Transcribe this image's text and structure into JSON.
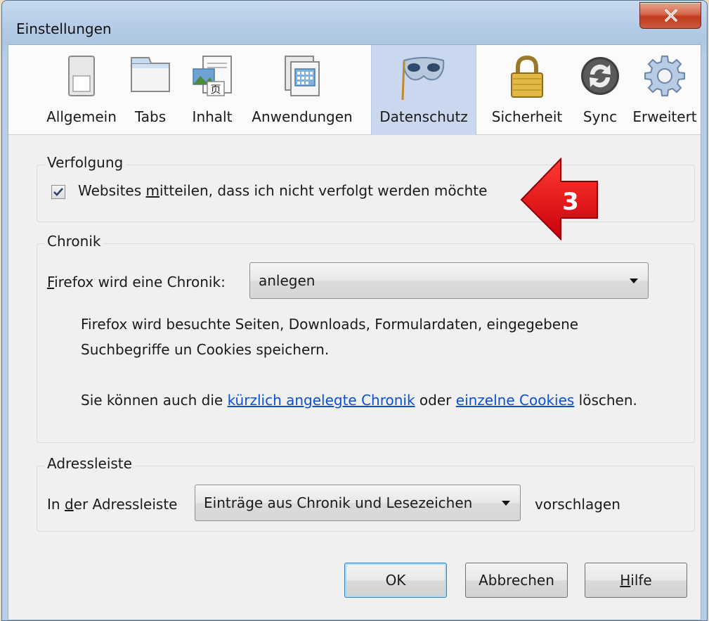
{
  "window": {
    "title": "Einstellungen",
    "close_icon": "close-icon"
  },
  "toolbar": {
    "items": [
      {
        "label": "Allgemein",
        "icon": "switch-icon",
        "selected": false
      },
      {
        "label": "Tabs",
        "icon": "tab-window-icon",
        "selected": false
      },
      {
        "label": "Inhalt",
        "icon": "content-image-icon",
        "selected": false
      },
      {
        "label": "Anwendungen",
        "icon": "applications-icon",
        "selected": false
      },
      {
        "label": "Datenschutz",
        "icon": "mask-icon",
        "selected": true
      },
      {
        "label": "Sicherheit",
        "icon": "padlock-icon",
        "selected": false
      },
      {
        "label": "Sync",
        "icon": "sync-icon",
        "selected": false
      },
      {
        "label": "Erweitert",
        "icon": "gear-icon",
        "selected": false
      }
    ]
  },
  "tracking": {
    "legend": "Verfolgung",
    "checkbox_label_pre": "Websites ",
    "checkbox_label_accel": "m",
    "checkbox_label_post": "itteilen, dass ich nicht verfolgt werden möchte",
    "checked": true
  },
  "annotation": {
    "number": "3",
    "color": "#e8101a"
  },
  "history": {
    "legend": "Chronik",
    "select_label_accel": "F",
    "select_label_rest": "irefox wird eine Chronik:",
    "select_value": "anlegen",
    "description_line1": "Firefox wird besuchte Seiten, Downloads, Formulardaten, eingegebene",
    "description_line2": "Suchbegriffe un  Cookies speichern.",
    "clear_text_pre": "Sie können auch die ",
    "clear_link1": "kürzlich angelegte Chronik",
    "clear_text_mid": " oder ",
    "clear_link2": "einzelne Cookies",
    "clear_text_post": " löschen."
  },
  "addressbar": {
    "legend": "Adressleiste",
    "label_pre": "In ",
    "label_accel": "d",
    "label_post": "er Adressleiste",
    "select_value": "Einträge aus Chronik und Lesezeichen",
    "suffix": "vorschlagen"
  },
  "buttons": {
    "ok": "OK",
    "cancel": "Abbrechen",
    "help_accel": "H",
    "help_rest": "ilfe"
  }
}
